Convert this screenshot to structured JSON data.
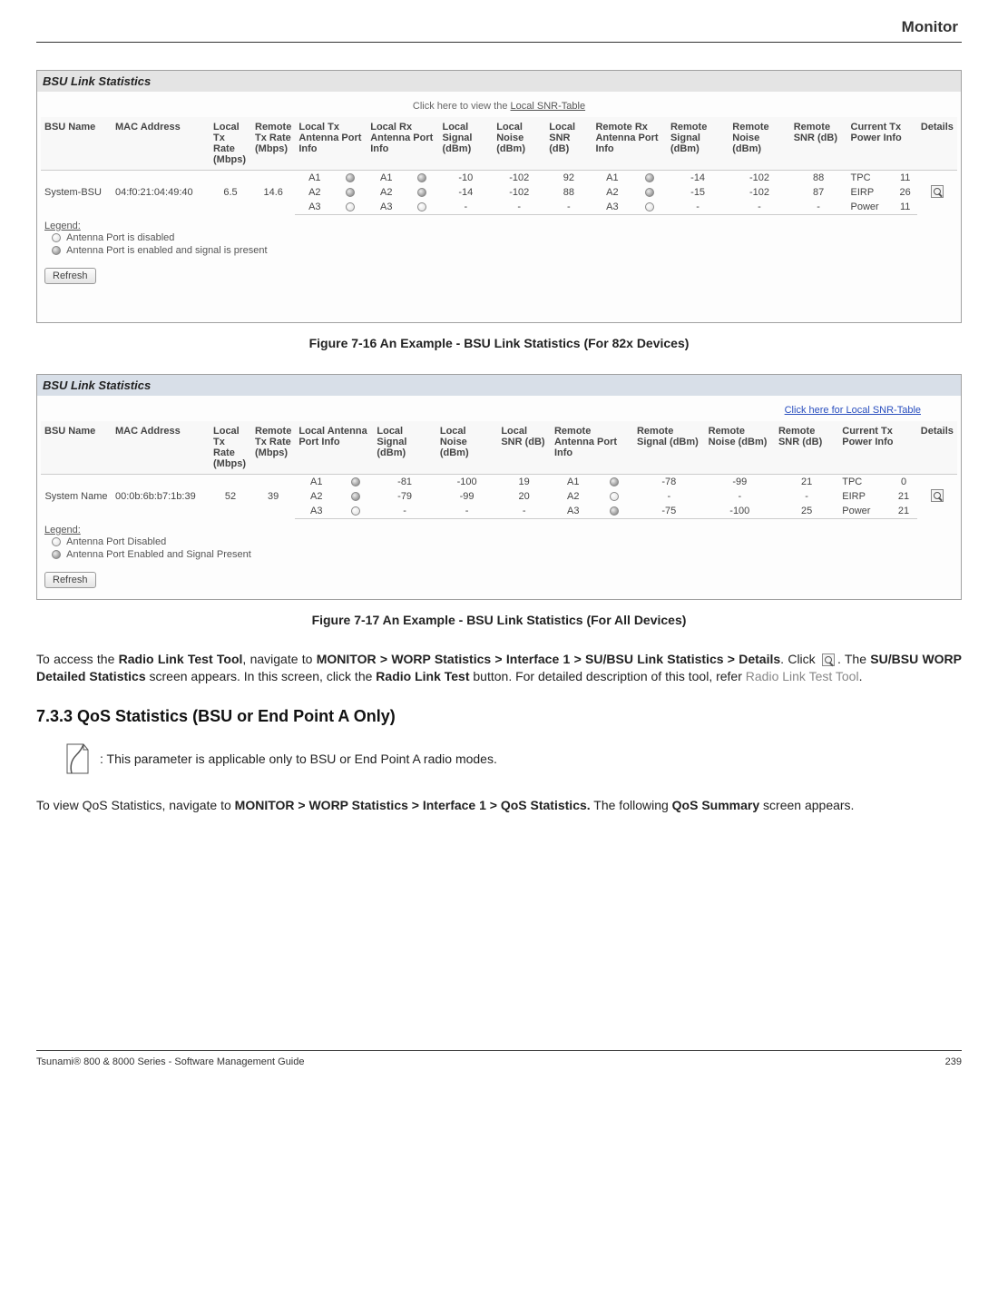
{
  "header": {
    "title": "Monitor"
  },
  "fig16": {
    "panelTitle": "BSU Link Statistics",
    "snrPrefix": "Click here to view the ",
    "snrLink": "Local SNR-Table",
    "headers": [
      "BSU Name",
      "MAC Address",
      "Local Tx Rate (Mbps)",
      "Remote Tx Rate (Mbps)",
      "Local Tx Antenna Port Info",
      "Local Rx Antenna Port Info",
      "Local Signal (dBm)",
      "Local Noise (dBm)",
      "Local SNR (dB)",
      "Remote Rx Antenna Port Info",
      "Remote Signal (dBm)",
      "Remote Noise (dBm)",
      "Remote SNR (dB)",
      "Current Tx Power Info",
      "Details"
    ],
    "bsuName": "System-BSU",
    "mac": "04:f0:21:04:49:40",
    "localTx": "6.5",
    "remoteTx": "14.6",
    "rows": [
      {
        "txAnt": "A1",
        "txEn": true,
        "rxAnt": "A1",
        "rxEn": true,
        "lSig": "-10",
        "lNoise": "-102",
        "lSnr": "92",
        "rAnt": "A1",
        "rEn": true,
        "rSig": "-14",
        "rNoise": "-102",
        "rSnr": "88",
        "pwrLbl": "TPC",
        "pwrVal": "11"
      },
      {
        "txAnt": "A2",
        "txEn": true,
        "rxAnt": "A2",
        "rxEn": true,
        "lSig": "-14",
        "lNoise": "-102",
        "lSnr": "88",
        "rAnt": "A2",
        "rEn": true,
        "rSig": "-15",
        "rNoise": "-102",
        "rSnr": "87",
        "pwrLbl": "EIRP",
        "pwrVal": "26"
      },
      {
        "txAnt": "A3",
        "txEn": false,
        "rxAnt": "A3",
        "rxEn": false,
        "lSig": "-",
        "lNoise": "-",
        "lSnr": "-",
        "rAnt": "A3",
        "rEn": false,
        "rSig": "-",
        "rNoise": "-",
        "rSnr": "-",
        "pwrLbl": "Power",
        "pwrVal": "11"
      }
    ],
    "legendTitle": "Legend:",
    "legendDisabled": "Antenna Port is disabled",
    "legendEnabled": "Antenna Port is enabled and signal is present",
    "refresh": "Refresh",
    "caption": "Figure 7-16 An Example - BSU Link Statistics (For 82x Devices)"
  },
  "fig17": {
    "panelTitle": "BSU Link Statistics",
    "snrLink": "Click here for Local SNR-Table",
    "headers": [
      "BSU Name",
      "MAC Address",
      "Local Tx Rate (Mbps)",
      "Remote Tx Rate (Mbps)",
      "Local Antenna Port Info",
      "Local Signal (dBm)",
      "Local Noise (dBm)",
      "Local SNR (dB)",
      "Remote Antenna Port Info",
      "Remote Signal (dBm)",
      "Remote Noise (dBm)",
      "Remote SNR (dB)",
      "Current Tx Power Info",
      "Details"
    ],
    "bsuName": "System Name",
    "mac": "00:0b:6b:b7:1b:39",
    "localTx": "52",
    "remoteTx": "39",
    "rows": [
      {
        "lAnt": "A1",
        "lEn": true,
        "lSig": "-81",
        "lNoise": "-100",
        "lSnr": "19",
        "rAnt": "A1",
        "rEn": true,
        "rSig": "-78",
        "rNoise": "-99",
        "rSnr": "21",
        "pwrLbl": "TPC",
        "pwrVal": "0"
      },
      {
        "lAnt": "A2",
        "lEn": true,
        "lSig": "-79",
        "lNoise": "-99",
        "lSnr": "20",
        "rAnt": "A2",
        "rEn": false,
        "rSig": "-",
        "rNoise": "-",
        "rSnr": "-",
        "pwrLbl": "EIRP",
        "pwrVal": "21"
      },
      {
        "lAnt": "A3",
        "lEn": false,
        "lSig": "-",
        "lNoise": "-",
        "lSnr": "-",
        "rAnt": "A3",
        "rEn": true,
        "rSig": "-75",
        "rNoise": "-100",
        "rSnr": "25",
        "pwrLbl": "Power",
        "pwrVal": "21"
      }
    ],
    "legendTitle": "Legend:",
    "legendDisabled": "Antenna Port Disabled",
    "legendEnabled": "Antenna Port Enabled and Signal Present",
    "refresh": "Refresh",
    "caption": "Figure 7-17 An Example - BSU Link Statistics (For All Devices)"
  },
  "para1": {
    "p1": "To access the ",
    "b1": "Radio Link Test Tool",
    "p2": ", navigate to ",
    "b2": "MONITOR > WORP Statistics > Interface 1 > SU/BSU Link Statistics > Details",
    "p3": ". Click ",
    "p4": ". The ",
    "b3": "SU/BSU WORP Detailed Statistics",
    "p5": " screen appears. In this screen, click the ",
    "b4": "Radio Link Test",
    "p6": " button. For detailed description of this tool, refer ",
    "link": "Radio Link Test Tool",
    "p7": "."
  },
  "sectionTitle": "7.3.3 QoS Statistics (BSU or End Point A Only)",
  "note": ": This parameter is applicable only to BSU or End Point A radio modes.",
  "para2": {
    "p1": "To view QoS Statistics, navigate to ",
    "b1": "MONITOR > WORP Statistics > Interface 1 > QoS Statistics.",
    "p2": " The following ",
    "b2": "QoS Summary",
    "p3": " screen appears."
  },
  "footer": {
    "left": "Tsunami® 800 & 8000 Series - Software Management Guide",
    "right": "239"
  }
}
